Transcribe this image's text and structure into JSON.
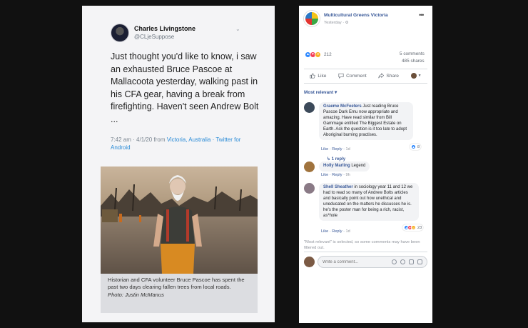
{
  "tweet": {
    "name": "Charles Livingstone",
    "handle": "@CLjeSuppose",
    "text": "Just thought you'd like to know, i saw an exhausted Bruce Pascoe at Mallacoota yesterday, walking past in his CFA gear, having a break from firefighting. Haven't seen Andrew Bolt ...",
    "meta_time": "7:42 am · 4/1/20 from ",
    "meta_place": "Victoria, Australia",
    "meta_sep": " · ",
    "meta_client": "Twitter for Android",
    "photo_caption": "Historian and CFA volunteer Bruce Pascoe has spent the past two days clearing fallen trees from local roads.",
    "photo_credit": "Photo: Justin McManus"
  },
  "facebook": {
    "page_name": "Multicultural Greens Victoria",
    "post_time": "Yesterday ·",
    "more_label": "•••",
    "reaction_count": "212",
    "comments_count": "5 comments",
    "shares_count": "485 shares",
    "actions": {
      "like": "Like",
      "comment": "Comment",
      "share": "Share"
    },
    "sort_label": "Most relevant ▾",
    "comments": [
      {
        "author": "Graeme McFeeters",
        "text": "Just reading Bruce Pascoe Dark Emu now appropriate and amazing. Have read similar from Bill Gammage entitled The Biggest Estate on Earth. Ask the question is it too late to adopt Aboriginal burning practises.",
        "like": "Like",
        "reply": "Reply",
        "age": "1d",
        "reaction_count": "8",
        "reply_link": "↳ 1 reply"
      },
      {
        "author": "Holly Marling",
        "text": "Legend",
        "like": "Like",
        "reply": "Reply",
        "age": "9h"
      },
      {
        "author": "Shell Sheather",
        "text": "in sociology year 11 and 12 we had to read so many of Andrew Bolts articles and basically point out how unethical and uneducated on the matters he discusses he is. he's the poster man for being a rich, racist, as*hole",
        "like": "Like",
        "reply": "Reply",
        "age": "1d",
        "reaction_count": "23"
      }
    ],
    "filter_note": "\"Most relevant\" is selected, so some comments may have been filtered out.",
    "compose_placeholder": "Write a comment...",
    "colors": {
      "link": "#385898",
      "like_blue": "#2d88ff",
      "love_red": "#f33e58",
      "wow_yellow": "#f7b125"
    }
  }
}
